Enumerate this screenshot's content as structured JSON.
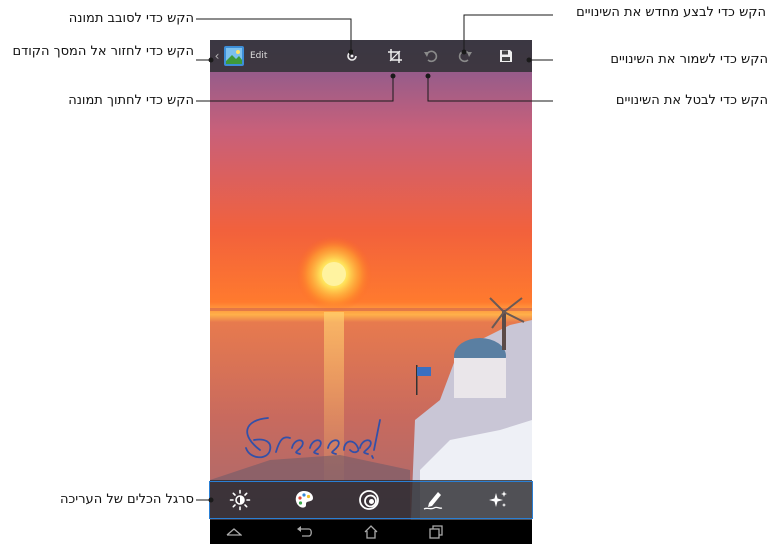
{
  "topbar": {
    "back_icon": "chevron-left-icon",
    "edit_label": "Edit",
    "icons": [
      "rotate-icon",
      "crop-icon",
      "undo-icon",
      "redo-icon",
      "save-icon"
    ]
  },
  "photo": {
    "handwriting": "Greece!"
  },
  "toolbar": {
    "icons": [
      "brightness-icon",
      "palette-icon",
      "effects-icon",
      "draw-icon",
      "sparkle-icon"
    ]
  },
  "navbar": {
    "icons": [
      "home-up-icon",
      "back-arrow-icon",
      "home-icon",
      "recent-apps-icon"
    ]
  },
  "annotations": {
    "rotate": "הקש כדי לסובב תמונה",
    "back": "הקש כדי לחזור אל המסך הקודם",
    "crop": "הקש כדי לחתוך תמונה",
    "redo": "הקש כדי לבצע מחדש את השינויים",
    "save": "הקש כדי לשמור את השינויים",
    "undo": "הקש כדי לבטל את השינויים",
    "toolbar": "סרגל הכלים של העריכה"
  },
  "colors": {
    "callout_line": "#1a1a1a",
    "highlight": "#2a7fd4",
    "sky_top": "#8a5a92",
    "sky_mid": "#f25a32",
    "sun": "#ffe66a",
    "sea": "#d96a4a"
  }
}
